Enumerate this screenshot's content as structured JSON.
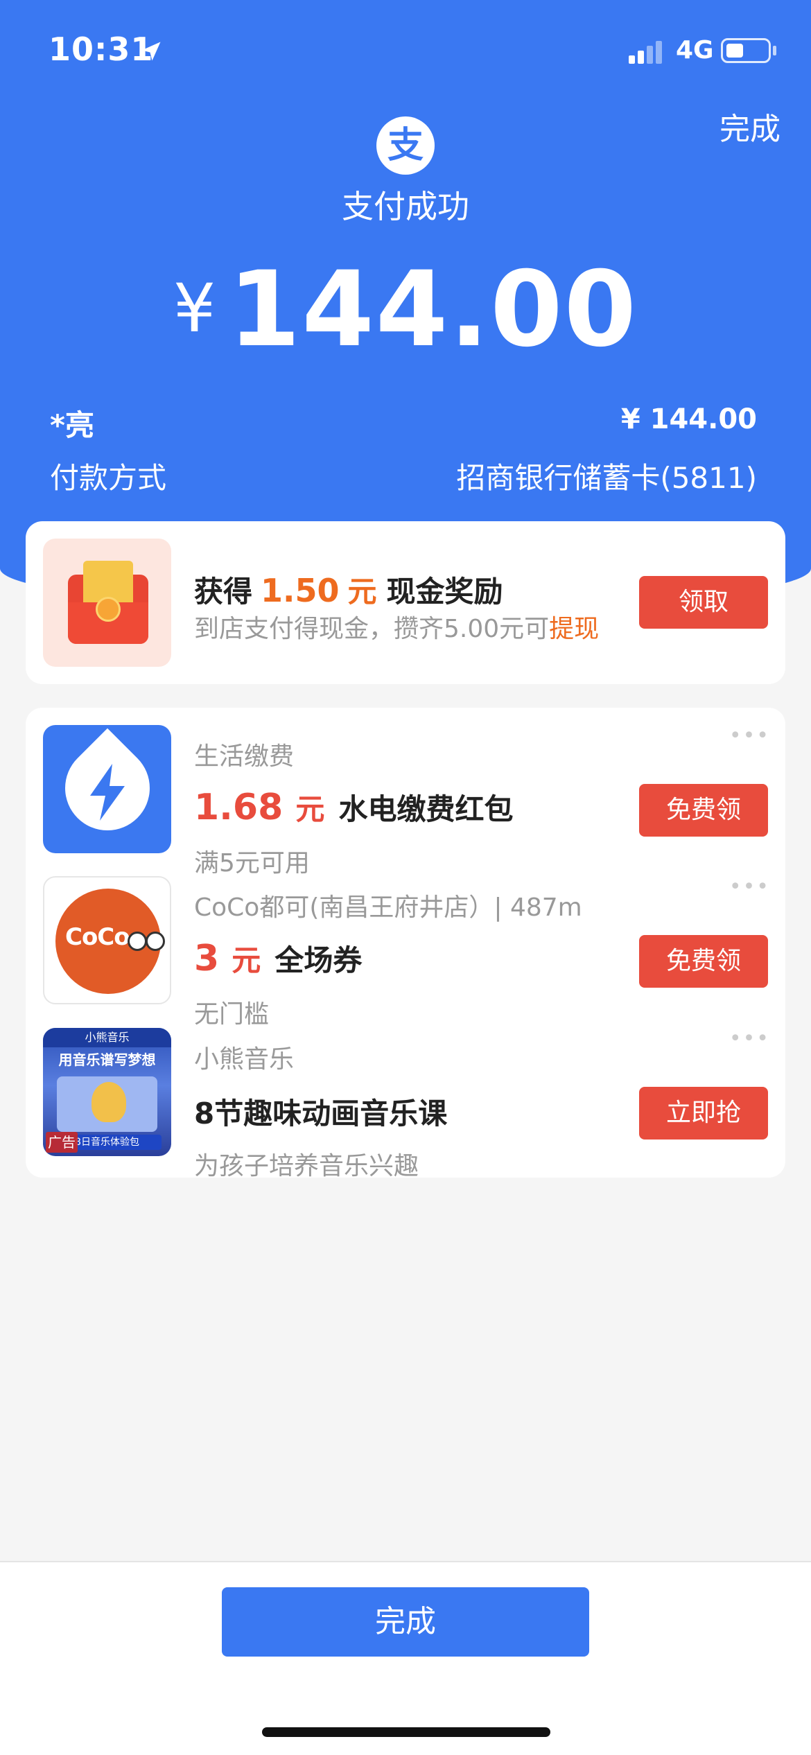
{
  "status_bar": {
    "time": "10:31",
    "network": "4G"
  },
  "header": {
    "done_label": "完成",
    "logo_glyph": "支",
    "title": "支付成功",
    "currency": "¥",
    "amount": "144.00"
  },
  "payment": {
    "payee": "*亮",
    "payee_amount": "¥ 144.00",
    "method_label": "付款方式",
    "method_value": "招商银行储蓄卡(5811)"
  },
  "reward": {
    "prefix": "获得",
    "value": "1.50",
    "unit": "元",
    "suffix": "现金奖励",
    "sub_text": "到店支付得现金，攒齐5.00元可",
    "sub_link": "提现",
    "button": "领取"
  },
  "offers": [
    {
      "category": "生活缴费",
      "price": "1.68",
      "unit": "元",
      "title": "水电缴费红包",
      "note": "满5元可用",
      "button": "免费领"
    },
    {
      "category": "CoCo都可(南昌王府井店）| 487m",
      "price": "3",
      "unit": "元",
      "title": "全场券",
      "note": "无门槛",
      "button": "免费领",
      "logo_text": "CoCo"
    },
    {
      "category": "小熊音乐",
      "title": "8节趣味动画音乐课",
      "note": "为孩子培养音乐兴趣",
      "button": "立即抢",
      "ad_tag": "广告",
      "thumb_head": "小熊音乐",
      "thumb_title": "用音乐谱写梦想",
      "thumb_foot": "8日音乐体验包"
    }
  ],
  "more_icon": "•••",
  "footer": {
    "done_button": "完成"
  },
  "colors": {
    "brand_blue": "#3a78f2",
    "action_red": "#e84c3d",
    "reward_orange": "#ee6b1f"
  }
}
